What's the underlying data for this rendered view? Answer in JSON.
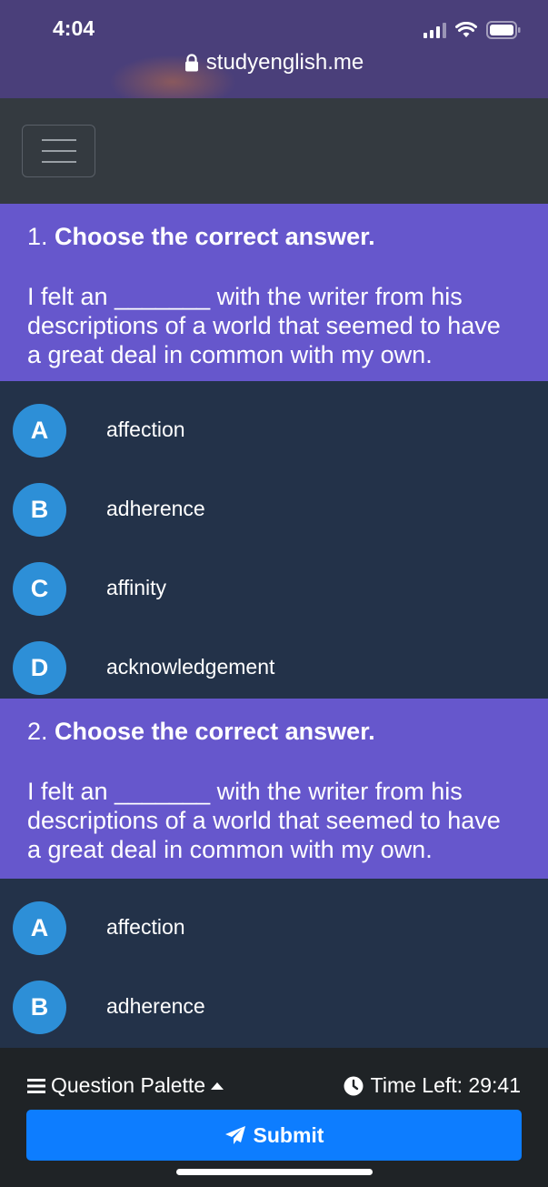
{
  "status_bar": {
    "time": "4:04",
    "url": "studyenglish.me"
  },
  "colors": {
    "question_bg": "#6657cc",
    "options_bg": "#233249",
    "option_circle": "#2d8fd7",
    "submit": "#0d7dff",
    "navbar": "#343a40"
  },
  "questions": [
    {
      "number": "1.",
      "title": "Choose the correct answer.",
      "text": "I felt an _______ with the writer from his descriptions of a world that seemed to have a great deal in common with my own.",
      "options": [
        {
          "letter": "A",
          "text": "affection"
        },
        {
          "letter": "B",
          "text": "adherence"
        },
        {
          "letter": "C",
          "text": "affinity"
        },
        {
          "letter": "D",
          "text": "acknowledgement"
        }
      ]
    },
    {
      "number": "2.",
      "title": "Choose the correct answer.",
      "text": "I felt an _______ with the writer from his descriptions of a world that seemed to have a great deal in common with my own.",
      "options": [
        {
          "letter": "A",
          "text": "affection"
        },
        {
          "letter": "B",
          "text": "adherence"
        }
      ]
    }
  ],
  "footer": {
    "palette_label": "Question Palette",
    "time_left": "Time Left: 29:41",
    "submit_label": "Submit"
  }
}
